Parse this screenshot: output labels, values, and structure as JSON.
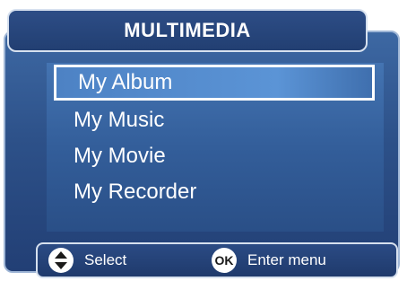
{
  "title": "MULTIMEDIA",
  "menu": {
    "items": [
      {
        "label": "My Album",
        "selected": true
      },
      {
        "label": "My Music",
        "selected": false
      },
      {
        "label": "My Movie",
        "selected": false
      },
      {
        "label": "My Recorder",
        "selected": false
      }
    ]
  },
  "footer": {
    "select_icon": "up-down-arrows-icon",
    "select_label": "Select",
    "ok_icon_text": "OK",
    "enter_label": "Enter menu"
  },
  "colors": {
    "frame": "#2d5189",
    "panel": "#4474b2",
    "highlight_border": "#ffffff",
    "text": "#ffffff"
  }
}
